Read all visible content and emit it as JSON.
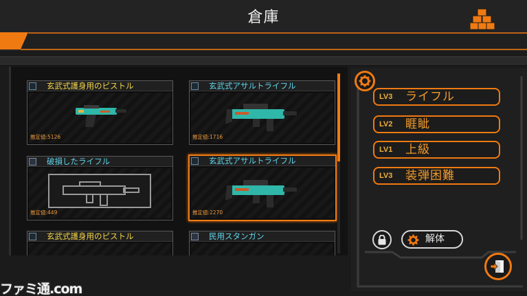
{
  "header": {
    "title": "倉庫",
    "cubes_icon": "cubes-icon"
  },
  "colors": {
    "accent": "#f07a12",
    "background": "#1b1b1b",
    "weapon_teal": "#2fb7a9",
    "yellow_name": "#f3d54a",
    "cyan_name": "#5fd6ec"
  },
  "inventory": {
    "items": [
      {
        "name": "玄武式護身用のピストル",
        "value": "推定値:5126",
        "name_color": "yellow",
        "weapon": "pistol-icon",
        "selected": false
      },
      {
        "name": "玄武式アサルトライフル",
        "value": "推定値:1716",
        "name_color": "cyan",
        "weapon": "assault-rifle-icon",
        "selected": false
      },
      {
        "name": "破損したライフル",
        "value": "推定値:449",
        "name_color": "cyan",
        "weapon": "broken-rifle-icon",
        "selected": false
      },
      {
        "name": "玄武式アサルトライフル",
        "value": "推定値:2270",
        "name_color": "cyan",
        "weapon": "assault-rifle-icon",
        "selected": true
      },
      {
        "name": "玄武式護身用のピストル",
        "value": "",
        "name_color": "yellow",
        "weapon": "pistol-icon",
        "selected": false
      },
      {
        "name": "民用スタンガン",
        "value": "",
        "name_color": "cyan",
        "weapon": "stun-gun-icon",
        "selected": false
      }
    ]
  },
  "details": {
    "skills": [
      {
        "level": "LV3",
        "name": "ライフル"
      },
      {
        "level": "LV2",
        "name": "睚眦"
      },
      {
        "level": "LV1",
        "name": "上級"
      },
      {
        "level": "LV3",
        "name": "装弾困難"
      }
    ],
    "lock_icon": "lock-icon",
    "dismantle_label": "解体",
    "exit_icon": "exit-icon"
  },
  "watermark": "ファミ通.com"
}
